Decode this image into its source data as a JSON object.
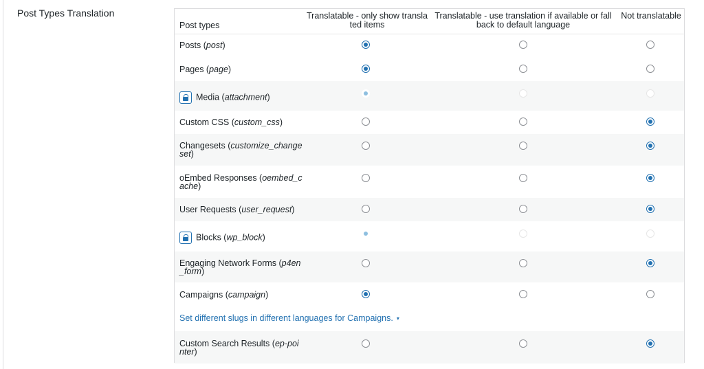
{
  "section_title": "Post Types Translation",
  "columns": {
    "name": "Post types",
    "col1": "Translatable - only show translated items",
    "col2": "Translatable - use translation if available or fallback to default language",
    "col3": "Not translatable"
  },
  "rows": [
    {
      "label": "Posts",
      "slug": "post",
      "selected": 1,
      "locked": false
    },
    {
      "label": "Pages",
      "slug": "page",
      "selected": 1,
      "locked": false
    },
    {
      "label": "Media",
      "slug": "attachment",
      "selected": 1,
      "locked": true
    },
    {
      "label": "Custom CSS",
      "slug": "custom_css",
      "selected": 3,
      "locked": false
    },
    {
      "label": "Changesets",
      "slug": "customize_changeset",
      "selected": 3,
      "locked": false
    },
    {
      "label": "oEmbed Responses",
      "slug": "oembed_cache",
      "selected": 3,
      "locked": false
    },
    {
      "label": "User Requests",
      "slug": "user_request",
      "selected": 3,
      "locked": false
    },
    {
      "label": "Blocks",
      "slug": "wp_block",
      "selected": 1,
      "locked": true
    },
    {
      "label": "Engaging Network Forms",
      "slug": "p4en_form",
      "selected": 3,
      "locked": false
    },
    {
      "label": "Campaigns",
      "slug": "campaign",
      "selected": 1,
      "locked": false
    },
    {
      "label": "Custom Search Results",
      "slug": "ep-pointer",
      "selected": 3,
      "locked": false
    }
  ],
  "slug_link": "Set different slugs in different languages for Campaigns.",
  "slug_caret": "▾"
}
